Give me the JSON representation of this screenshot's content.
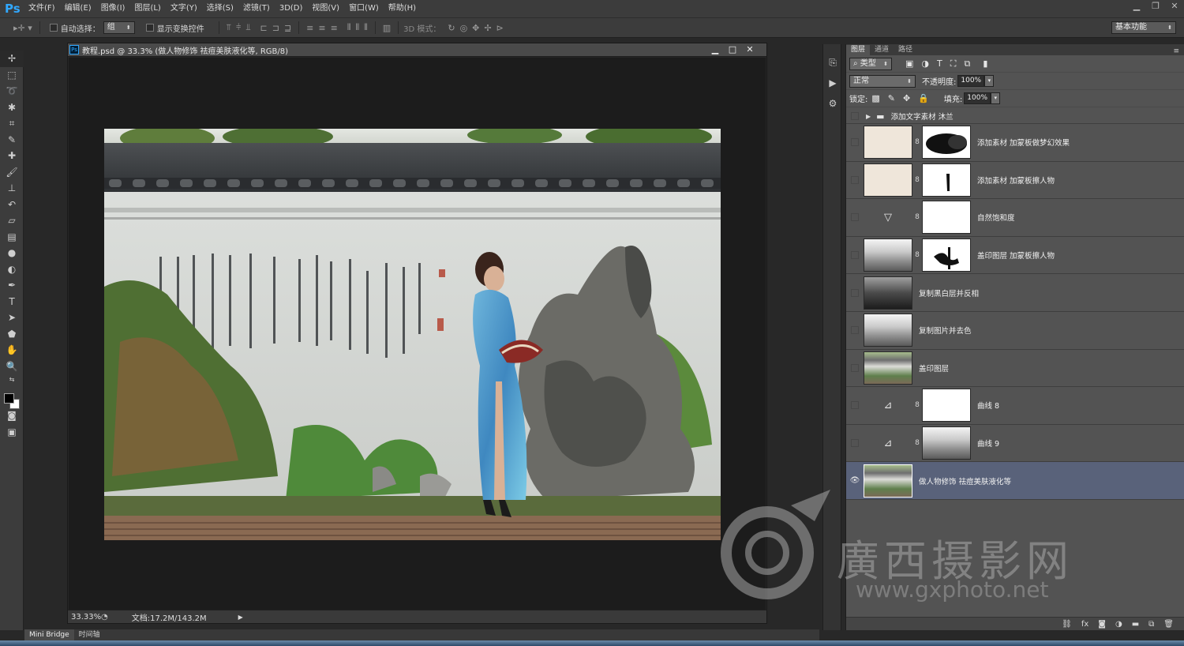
{
  "app": {
    "logo": "Ps"
  },
  "menu": [
    "文件(F)",
    "编辑(E)",
    "图像(I)",
    "图层(L)",
    "文字(Y)",
    "选择(S)",
    "滤镜(T)",
    "3D(D)",
    "视图(V)",
    "窗口(W)",
    "帮助(H)"
  ],
  "options_bar": {
    "auto_select_label": "自动选择：",
    "auto_select_value": "组",
    "show_transform_label": "显示变换控件",
    "mode_3d_label": "3D 模式：",
    "workspace": "基本功能"
  },
  "document": {
    "title": "教程.psd @ 33.3% (做人物修饰  祛痘美肤液化等, RGB/8)",
    "zoom": "33.33%",
    "info": "文档:17.2M/143.2M"
  },
  "bottom_tabs": [
    "Mini Bridge",
    "时间轴"
  ],
  "layers_panel": {
    "tabs": [
      "图层",
      "通道",
      "路径"
    ],
    "filter_kind": "类型",
    "blend_mode": "正常",
    "opacity_label": "不透明度:",
    "opacity": "100%",
    "lock_label": "锁定:",
    "fill_label": "填充:",
    "fill": "100%",
    "group": "添加文字素材  沐兰",
    "layers": [
      {
        "name": "添加素材  加蒙板做梦幻效果",
        "visible": false,
        "selected": false
      },
      {
        "name": "添加素材  加蒙板擦人物",
        "visible": false,
        "selected": false
      },
      {
        "name": "自然饱和度",
        "visible": false,
        "selected": false
      },
      {
        "name": "盖印图层  加蒙板擦人物",
        "visible": false,
        "selected": false
      },
      {
        "name": "复制黑白层并反相",
        "visible": false,
        "selected": false
      },
      {
        "name": "复制图片并去色",
        "visible": false,
        "selected": false
      },
      {
        "name": "盖印图层",
        "visible": false,
        "selected": false
      },
      {
        "name": "曲线 8",
        "visible": false,
        "selected": false
      },
      {
        "name": "曲线 9",
        "visible": false,
        "selected": false
      },
      {
        "name": "做人物修饰  祛痘美肤液化等",
        "visible": true,
        "selected": true
      }
    ]
  },
  "watermark": {
    "cn": "廣西摄影网",
    "url": "www.gxphoto.net"
  },
  "colors": {
    "accent": "#31a8ff",
    "selected_layer": "#59627a"
  }
}
